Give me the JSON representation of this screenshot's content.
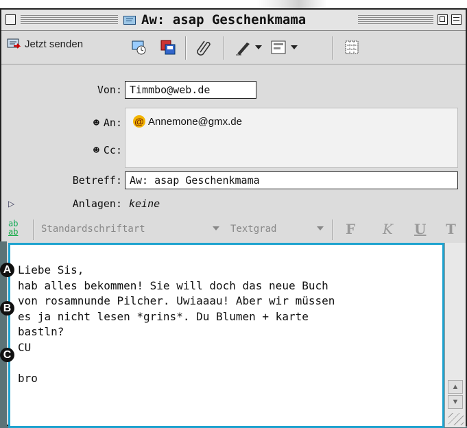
{
  "window": {
    "title": "Aw: asap Geschenkmama"
  },
  "toolbar": {
    "send_label": "Jetzt senden",
    "icons": [
      "send-icon",
      "address-book-icon",
      "save-icon",
      "attach-icon",
      "signature-icon",
      "priority-icon",
      "grid-icon"
    ]
  },
  "header": {
    "from_label": "Von:",
    "from_value": "Timmbo@web.de",
    "to_label": "An:",
    "to_value": "Annemone@gmx.de",
    "cc_label": "Cc:",
    "subject_label": "Betreff:",
    "subject_value": "Aw: asap Geschenkmama",
    "attach_label": "Anlagen:",
    "attach_value": "keine"
  },
  "format": {
    "font_select": "Standardschriftart",
    "size_select": "Textgrad",
    "bold": "F",
    "italic": "K",
    "underline": "U",
    "typewriter": "T"
  },
  "body": {
    "lines": [
      "Liebe Sis,",
      "hab alles bekommen! Sie will doch das neue Buch",
      "von rosamnunde Pilcher. Uwiaaau! Aber wir müssen",
      "es ja nicht lesen *grins*. Du Blumen + karte",
      "bastln?",
      "CU",
      "",
      "bro"
    ]
  },
  "markers": [
    "A",
    "B",
    "C"
  ],
  "colors": {
    "accent": "#1fa3cf",
    "background": "#5b7377"
  }
}
